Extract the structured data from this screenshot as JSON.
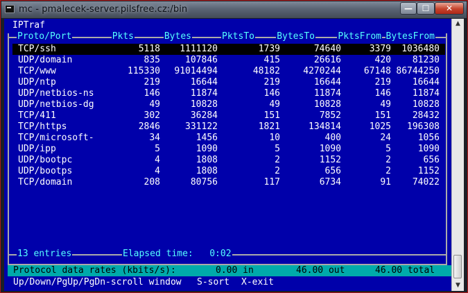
{
  "window": {
    "title": "mc - pmalecek-server.pilsfree.cz:/bin",
    "min_label": "—",
    "max_label": "☐",
    "close_label": "✕"
  },
  "app_title": "IPTraf",
  "headers": [
    "Proto/Port",
    "Pkts",
    "Bytes",
    "PktsTo",
    "BytesTo",
    "PktsFrom",
    "BytesFrom"
  ],
  "rows": [
    {
      "proto": "TCP/ssh",
      "pkts": "5118",
      "bytes": "1111120",
      "pkts_to": "1739",
      "bytes_to": "74640",
      "pkts_from": "3379",
      "bytes_from": "1036480"
    },
    {
      "proto": "UDP/domain",
      "pkts": "835",
      "bytes": "107846",
      "pkts_to": "415",
      "bytes_to": "26616",
      "pkts_from": "420",
      "bytes_from": "81230"
    },
    {
      "proto": "TCP/www",
      "pkts": "115330",
      "bytes": "91014494",
      "pkts_to": "48182",
      "bytes_to": "4270244",
      "pkts_from": "67148",
      "bytes_from": "86744250"
    },
    {
      "proto": "UDP/ntp",
      "pkts": "219",
      "bytes": "16644",
      "pkts_to": "219",
      "bytes_to": "16644",
      "pkts_from": "219",
      "bytes_from": "16644"
    },
    {
      "proto": "UDP/netbios-ns",
      "pkts": "146",
      "bytes": "11874",
      "pkts_to": "146",
      "bytes_to": "11874",
      "pkts_from": "146",
      "bytes_from": "11874"
    },
    {
      "proto": "UDP/netbios-dg",
      "pkts": "49",
      "bytes": "10828",
      "pkts_to": "49",
      "bytes_to": "10828",
      "pkts_from": "49",
      "bytes_from": "10828"
    },
    {
      "proto": "TCP/411",
      "pkts": "302",
      "bytes": "36284",
      "pkts_to": "151",
      "bytes_to": "7852",
      "pkts_from": "151",
      "bytes_from": "28432"
    },
    {
      "proto": "TCP/https",
      "pkts": "2846",
      "bytes": "331122",
      "pkts_to": "1821",
      "bytes_to": "134814",
      "pkts_from": "1025",
      "bytes_from": "196308"
    },
    {
      "proto": "TCP/microsoft-",
      "pkts": "34",
      "bytes": "1456",
      "pkts_to": "10",
      "bytes_to": "400",
      "pkts_from": "24",
      "bytes_from": "1056"
    },
    {
      "proto": "UDP/ipp",
      "pkts": "5",
      "bytes": "1090",
      "pkts_to": "5",
      "bytes_to": "1090",
      "pkts_from": "5",
      "bytes_from": "1090"
    },
    {
      "proto": "UDP/bootpc",
      "pkts": "4",
      "bytes": "1808",
      "pkts_to": "2",
      "bytes_to": "1152",
      "pkts_from": "2",
      "bytes_from": "656"
    },
    {
      "proto": "UDP/bootps",
      "pkts": "4",
      "bytes": "1808",
      "pkts_to": "2",
      "bytes_to": "656",
      "pkts_from": "2",
      "bytes_from": "1152"
    },
    {
      "proto": "TCP/domain",
      "pkts": "208",
      "bytes": "80756",
      "pkts_to": "117",
      "bytes_to": "6734",
      "pkts_from": "91",
      "bytes_from": "74022"
    }
  ],
  "footer": {
    "entries": "13 entries",
    "elapsed": "Elapsed time:   0:02"
  },
  "status": {
    "label": "Protocol data rates (kbits/s):",
    "in_value": "0.00 in",
    "out_value": "46.00 out",
    "total_value": "46.00 total"
  },
  "hints": {
    "scroll": "Up/Down/PgUp/PgDn-scroll window",
    "sort": "S-sort",
    "exit": "X-exit"
  },
  "colors": {
    "terminal_bg": "#0000aa",
    "text": "#ffffff",
    "accent": "#55ffff",
    "status_bg": "#00aaaa",
    "selected_row_bg": "#000000"
  },
  "icons": {
    "window": "console-icon",
    "minimize": "minimize-icon",
    "maximize": "maximize-icon",
    "close": "close-icon",
    "scroll_up": "scroll-up-icon",
    "scroll_down": "scroll-down-icon"
  }
}
